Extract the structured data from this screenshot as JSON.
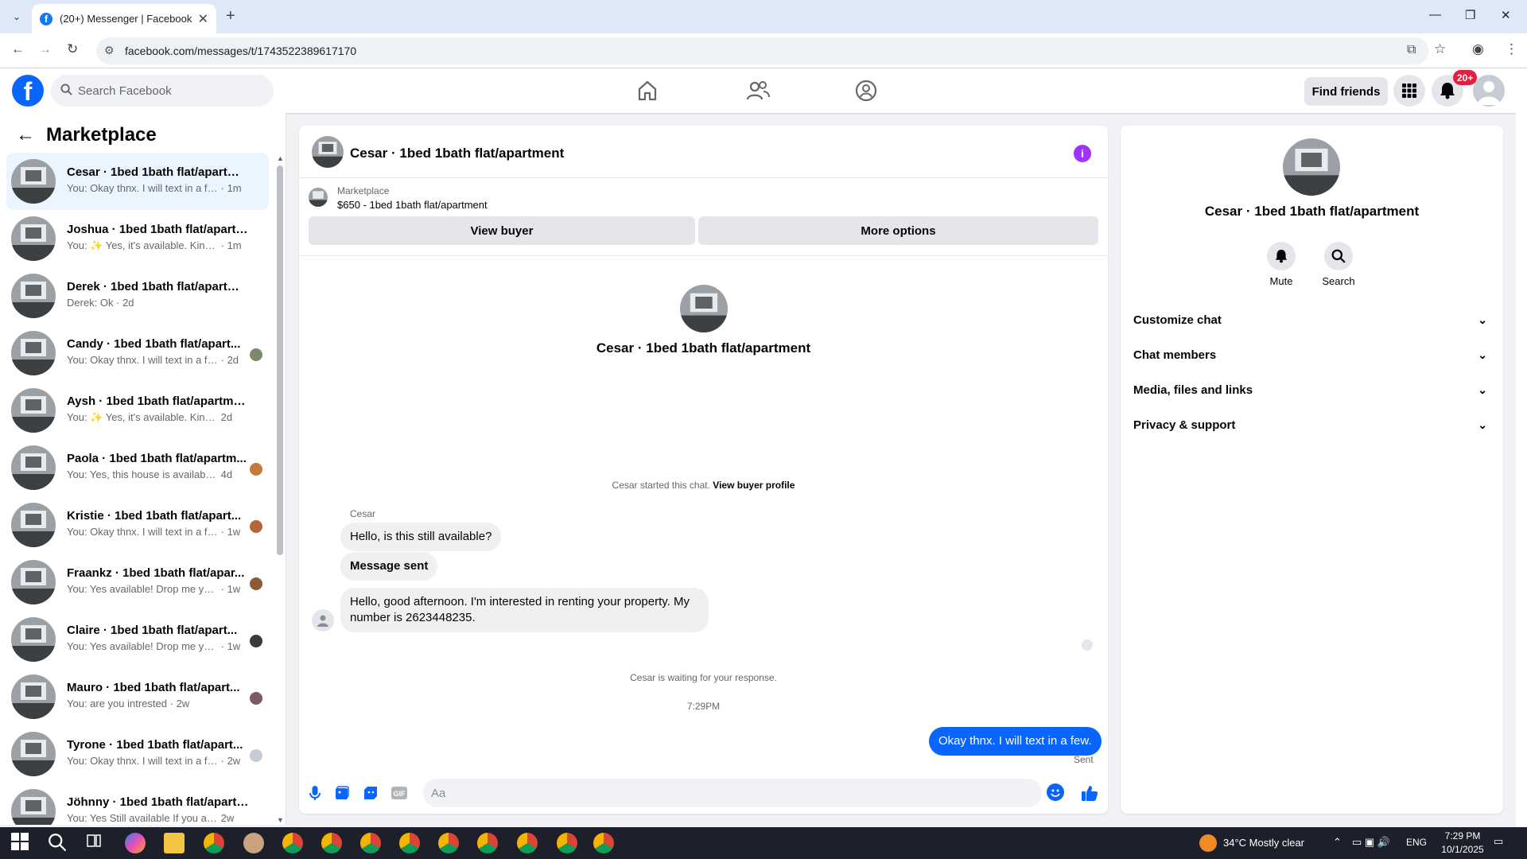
{
  "browser": {
    "tab_title": "(20+) Messenger | Facebook",
    "url": "facebook.com/messages/t/1743522389617170"
  },
  "fb": {
    "search_placeholder": "Search Facebook",
    "find_friends": "Find friends",
    "notif_badge": "20+"
  },
  "sidebar": {
    "title": "Marketplace",
    "conversations": [
      {
        "name": "Cesar · 1bed 1bath flat/apartment",
        "preview": "You: Okay thnx. I will text in a few.",
        "time": "· 1m",
        "active": true
      },
      {
        "name": "Joshua · 1bed 1bath flat/apartm...",
        "preview": "You: ✨ Yes, it's available. Kindly p...",
        "time": "· 1m"
      },
      {
        "name": "Derek · 1bed 1bath flat/apartment",
        "preview": "Derek: Ok",
        "time": "· 2d"
      },
      {
        "name": "Candy · 1bed 1bath flat/apart...",
        "preview": "You: Okay thnx. I will text in a few.",
        "time": "· 2d"
      },
      {
        "name": "Aysh · 1bed 1bath flat/apartment",
        "preview": "You: ✨ Yes, it's available. Kindly pr...",
        "time": "2d"
      },
      {
        "name": "Paola · 1bed 1bath flat/apartm...",
        "preview": "You: Yes, this house is available. ...",
        "time": "4d"
      },
      {
        "name": "Kristie · 1bed 1bath flat/apart...",
        "preview": "You: Okay thnx. I will text in a few.",
        "time": "· 1w"
      },
      {
        "name": "Fraankz · 1bed 1bath flat/apar...",
        "preview": "You: Yes available! Drop me you...",
        "time": "· 1w"
      },
      {
        "name": "Claire · 1bed 1bath flat/apart...",
        "preview": "You: Yes available! Drop me you...",
        "time": "· 1w"
      },
      {
        "name": "Mauro · 1bed 1bath flat/apart...",
        "preview": "You: are you intrested",
        "time": "· 2w"
      },
      {
        "name": "Tyrone · 1bed 1bath flat/apart...",
        "preview": "You: Okay thnx. I will text in a few.",
        "time": "· 2w"
      },
      {
        "name": "Jöhnny · 1bed 1bath flat/apartm...",
        "preview": "You: Yes Still available If you are int...",
        "time": "2w"
      }
    ]
  },
  "chat": {
    "header_name": "Cesar · 1bed 1bath flat/apartment",
    "listing_label": "Marketplace",
    "listing_title": "$650 - 1bed 1bath flat/apartment",
    "view_buyer": "View buyer",
    "more_options": "More options",
    "profile_name": "Cesar · 1bed 1bath flat/apartment",
    "started_text": "Cesar started this chat.",
    "view_buyer_profile": "View buyer profile",
    "sender": "Cesar",
    "messages_in": [
      "Hello, is this still available?",
      "Message sent",
      "Hello, good afternoon. I'm interested in renting your property. My number is 2623448235."
    ],
    "waiting": "Cesar is waiting for your response.",
    "time": "7:29PM",
    "message_out": "Okay thnx. I will text in a few.",
    "sent_label": "Sent",
    "composer_placeholder": "Aa"
  },
  "right": {
    "name": "Cesar · 1bed 1bath flat/apartment",
    "mute": "Mute",
    "search": "Search",
    "sections": [
      "Customize chat",
      "Chat members",
      "Media, files and links",
      "Privacy & support"
    ]
  },
  "taskbar": {
    "weather": "34°C  Mostly clear",
    "lang": "ENG",
    "time": "7:29 PM",
    "date": "10/1/2025"
  },
  "colors": {
    "fb_blue": "#0866ff",
    "info_purple": "#a033ff",
    "badge_red": "#e41e3f"
  }
}
